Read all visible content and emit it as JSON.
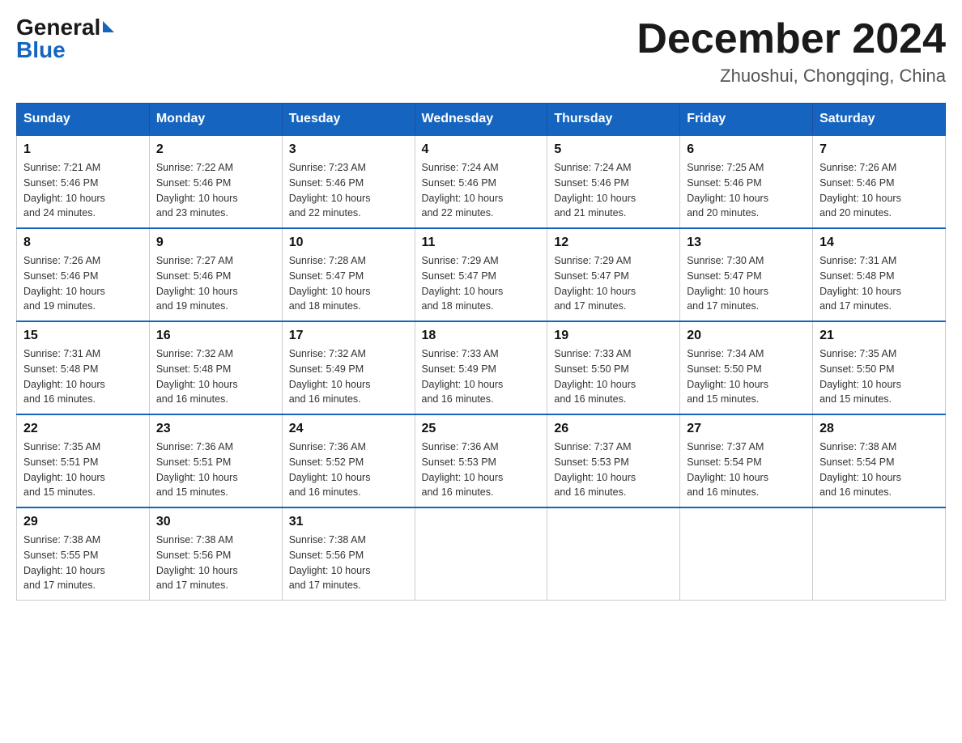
{
  "logo": {
    "general": "General",
    "blue": "Blue"
  },
  "title": {
    "month_year": "December 2024",
    "location": "Zhuoshui, Chongqing, China"
  },
  "headers": [
    "Sunday",
    "Monday",
    "Tuesday",
    "Wednesday",
    "Thursday",
    "Friday",
    "Saturday"
  ],
  "weeks": [
    [
      {
        "day": "1",
        "sunrise": "7:21 AM",
        "sunset": "5:46 PM",
        "daylight": "10 hours and 24 minutes."
      },
      {
        "day": "2",
        "sunrise": "7:22 AM",
        "sunset": "5:46 PM",
        "daylight": "10 hours and 23 minutes."
      },
      {
        "day": "3",
        "sunrise": "7:23 AM",
        "sunset": "5:46 PM",
        "daylight": "10 hours and 22 minutes."
      },
      {
        "day": "4",
        "sunrise": "7:24 AM",
        "sunset": "5:46 PM",
        "daylight": "10 hours and 22 minutes."
      },
      {
        "day": "5",
        "sunrise": "7:24 AM",
        "sunset": "5:46 PM",
        "daylight": "10 hours and 21 minutes."
      },
      {
        "day": "6",
        "sunrise": "7:25 AM",
        "sunset": "5:46 PM",
        "daylight": "10 hours and 20 minutes."
      },
      {
        "day": "7",
        "sunrise": "7:26 AM",
        "sunset": "5:46 PM",
        "daylight": "10 hours and 20 minutes."
      }
    ],
    [
      {
        "day": "8",
        "sunrise": "7:26 AM",
        "sunset": "5:46 PM",
        "daylight": "10 hours and 19 minutes."
      },
      {
        "day": "9",
        "sunrise": "7:27 AM",
        "sunset": "5:46 PM",
        "daylight": "10 hours and 19 minutes."
      },
      {
        "day": "10",
        "sunrise": "7:28 AM",
        "sunset": "5:47 PM",
        "daylight": "10 hours and 18 minutes."
      },
      {
        "day": "11",
        "sunrise": "7:29 AM",
        "sunset": "5:47 PM",
        "daylight": "10 hours and 18 minutes."
      },
      {
        "day": "12",
        "sunrise": "7:29 AM",
        "sunset": "5:47 PM",
        "daylight": "10 hours and 17 minutes."
      },
      {
        "day": "13",
        "sunrise": "7:30 AM",
        "sunset": "5:47 PM",
        "daylight": "10 hours and 17 minutes."
      },
      {
        "day": "14",
        "sunrise": "7:31 AM",
        "sunset": "5:48 PM",
        "daylight": "10 hours and 17 minutes."
      }
    ],
    [
      {
        "day": "15",
        "sunrise": "7:31 AM",
        "sunset": "5:48 PM",
        "daylight": "10 hours and 16 minutes."
      },
      {
        "day": "16",
        "sunrise": "7:32 AM",
        "sunset": "5:48 PM",
        "daylight": "10 hours and 16 minutes."
      },
      {
        "day": "17",
        "sunrise": "7:32 AM",
        "sunset": "5:49 PM",
        "daylight": "10 hours and 16 minutes."
      },
      {
        "day": "18",
        "sunrise": "7:33 AM",
        "sunset": "5:49 PM",
        "daylight": "10 hours and 16 minutes."
      },
      {
        "day": "19",
        "sunrise": "7:33 AM",
        "sunset": "5:50 PM",
        "daylight": "10 hours and 16 minutes."
      },
      {
        "day": "20",
        "sunrise": "7:34 AM",
        "sunset": "5:50 PM",
        "daylight": "10 hours and 15 minutes."
      },
      {
        "day": "21",
        "sunrise": "7:35 AM",
        "sunset": "5:50 PM",
        "daylight": "10 hours and 15 minutes."
      }
    ],
    [
      {
        "day": "22",
        "sunrise": "7:35 AM",
        "sunset": "5:51 PM",
        "daylight": "10 hours and 15 minutes."
      },
      {
        "day": "23",
        "sunrise": "7:36 AM",
        "sunset": "5:51 PM",
        "daylight": "10 hours and 15 minutes."
      },
      {
        "day": "24",
        "sunrise": "7:36 AM",
        "sunset": "5:52 PM",
        "daylight": "10 hours and 16 minutes."
      },
      {
        "day": "25",
        "sunrise": "7:36 AM",
        "sunset": "5:53 PM",
        "daylight": "10 hours and 16 minutes."
      },
      {
        "day": "26",
        "sunrise": "7:37 AM",
        "sunset": "5:53 PM",
        "daylight": "10 hours and 16 minutes."
      },
      {
        "day": "27",
        "sunrise": "7:37 AM",
        "sunset": "5:54 PM",
        "daylight": "10 hours and 16 minutes."
      },
      {
        "day": "28",
        "sunrise": "7:38 AM",
        "sunset": "5:54 PM",
        "daylight": "10 hours and 16 minutes."
      }
    ],
    [
      {
        "day": "29",
        "sunrise": "7:38 AM",
        "sunset": "5:55 PM",
        "daylight": "10 hours and 17 minutes."
      },
      {
        "day": "30",
        "sunrise": "7:38 AM",
        "sunset": "5:56 PM",
        "daylight": "10 hours and 17 minutes."
      },
      {
        "day": "31",
        "sunrise": "7:38 AM",
        "sunset": "5:56 PM",
        "daylight": "10 hours and 17 minutes."
      },
      null,
      null,
      null,
      null
    ]
  ],
  "labels": {
    "sunrise": "Sunrise:",
    "sunset": "Sunset:",
    "daylight": "Daylight:"
  }
}
